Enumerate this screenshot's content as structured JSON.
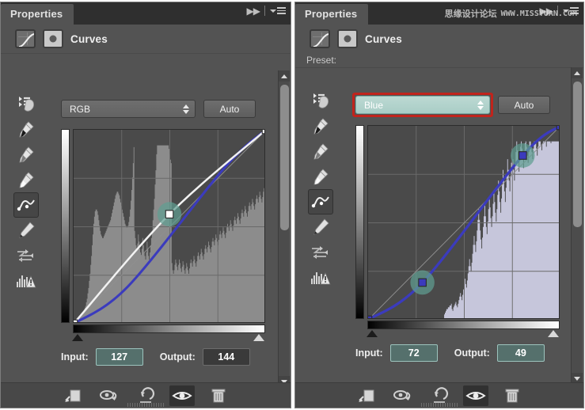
{
  "panels": [
    {
      "id": "left",
      "tab_label": "Properties",
      "adjustment_title": "Curves",
      "preset_label": "",
      "channel": {
        "value": "RGB",
        "highlighted": false
      },
      "auto_label": "Auto",
      "input": {
        "label": "Input:",
        "value": "127",
        "highlighted": true
      },
      "output": {
        "label": "Output:",
        "value": "144",
        "highlighted": false
      }
    },
    {
      "id": "right",
      "tab_label": "Properties",
      "adjustment_title": "Curves",
      "preset_label": "Preset:",
      "channel": {
        "value": "Blue",
        "highlighted": true
      },
      "auto_label": "Auto",
      "input": {
        "label": "Input:",
        "value": "72",
        "highlighted": true
      },
      "output": {
        "label": "Output:",
        "value": "49",
        "highlighted": true
      }
    }
  ],
  "watermark": {
    "cn": "思缘设计论坛",
    "en": "WWW.MISSYUAN.COM"
  },
  "tools": [
    {
      "name": "targeted-adjustment-tool",
      "label": "Targeted Adjustment Tool",
      "active": false
    },
    {
      "name": "black-point-eyedropper",
      "label": "Sample in Image to Set Black Point",
      "active": false
    },
    {
      "name": "gray-point-eyedropper",
      "label": "Sample in Image to Set Gray Point",
      "active": false
    },
    {
      "name": "white-point-eyedropper",
      "label": "Sample in Image to Set White Point",
      "active": false
    },
    {
      "name": "edit-points-curve-tool",
      "label": "Edit Points to Modify the Curve",
      "active": true
    },
    {
      "name": "pencil-draw-curve-tool",
      "label": "Draw to Modify the Curve",
      "active": false
    },
    {
      "name": "smooth-curve-values",
      "label": "Smooth the Curve Values",
      "active": false
    },
    {
      "name": "curves-display-options",
      "label": "Curves Display Options",
      "active": false
    }
  ],
  "bottom_toolbar": [
    {
      "name": "clip-to-layer-button",
      "label": "Clip to Layer",
      "active": false
    },
    {
      "name": "view-previous-state-button",
      "label": "View Previous State",
      "active": false
    },
    {
      "name": "reset-adjustment-button",
      "label": "Reset to Adjustment Defaults",
      "active": false
    },
    {
      "name": "toggle-layer-visibility-button",
      "label": "Toggle Layer Visibility",
      "active": true
    },
    {
      "name": "delete-adjustment-layer-button",
      "label": "Delete This Adjustment Layer",
      "active": false
    }
  ],
  "colors": {
    "panel_bg": "#535353",
    "titlebar_bg": "#2f2f2f",
    "plot_bg": "#4a4a4a",
    "blue_curve": "#3b3bbd",
    "white_curve": "#f2f2f2",
    "highlight_red": "#c0241c",
    "highlight_teal": "#a9cdc6",
    "point_glow": "#5f9e91",
    "histogram_gray": "#b4b4b4",
    "histogram_blue": "#dcdcf5"
  },
  "chart_data": [
    {
      "type": "line",
      "title": "RGB Curve",
      "xlabel": "Input",
      "ylabel": "Output",
      "xlim": [
        0,
        255
      ],
      "ylim": [
        0,
        255
      ],
      "grid": true,
      "series": [
        {
          "name": "white-composite-curve",
          "color": "#f2f2f2",
          "points": [
            [
              0,
              0
            ],
            [
              127,
              144
            ],
            [
              255,
              255
            ]
          ]
        },
        {
          "name": "blue-channel-curve",
          "color": "#3b3bbd",
          "points": [
            [
              0,
              0
            ],
            [
              72,
              49
            ],
            [
              200,
              205
            ],
            [
              255,
              255
            ]
          ]
        },
        {
          "name": "baseline-diagonal",
          "color": "#8a8a8a",
          "points": [
            [
              0,
              0
            ],
            [
              255,
              255
            ]
          ]
        }
      ],
      "control_points": [
        {
          "input": 0,
          "output": 0,
          "selected": false
        },
        {
          "input": 127,
          "output": 144,
          "selected": true
        },
        {
          "input": 255,
          "output": 255,
          "selected": false
        }
      ],
      "histogram_color": "#b4b4b4",
      "histogram": [
        2,
        2,
        2,
        2,
        3,
        3,
        3,
        4,
        4,
        5,
        5,
        6,
        6,
        7,
        8,
        9,
        10,
        12,
        14,
        17,
        20,
        24,
        28,
        33,
        38,
        44,
        50,
        56,
        60,
        63,
        64,
        64,
        63,
        61,
        58,
        55,
        52,
        50,
        49,
        48,
        48,
        49,
        50,
        51,
        52,
        53,
        54,
        55,
        56,
        57,
        58,
        60,
        62,
        64,
        66,
        68,
        70,
        72,
        73,
        74,
        74,
        73,
        72,
        70,
        68,
        66,
        64,
        62,
        60,
        58,
        56,
        55,
        54,
        54,
        55,
        57,
        60,
        64,
        69,
        75,
        82,
        90,
        99,
        52,
        48,
        44,
        42,
        45,
        50,
        46,
        42,
        40,
        38,
        42,
        48,
        44,
        40,
        38,
        36,
        40,
        46,
        42,
        38,
        36,
        40,
        44,
        48,
        52,
        58,
        64,
        70,
        78,
        86,
        95,
        100,
        100,
        100,
        100,
        100,
        100,
        100,
        100,
        100,
        100,
        100,
        100,
        100,
        100,
        100,
        100,
        98,
        95,
        92,
        90,
        34,
        30,
        28,
        30,
        33,
        36,
        34,
        32,
        30,
        33,
        36,
        34,
        31,
        29,
        32,
        35,
        33,
        30,
        28,
        31,
        34,
        32,
        30,
        28,
        31,
        34,
        36,
        34,
        32,
        35,
        38,
        36,
        34,
        32,
        35,
        38,
        40,
        38,
        36,
        39,
        42,
        40,
        38,
        36,
        39,
        42,
        44,
        42,
        40,
        43,
        46,
        44,
        42,
        40,
        43,
        46,
        48,
        46,
        44,
        47,
        50,
        48,
        46,
        44,
        47,
        50,
        52,
        50,
        48,
        51,
        54,
        52,
        50,
        48,
        51,
        54,
        56,
        54,
        52,
        55,
        58,
        56,
        54,
        52,
        55,
        58,
        60,
        58,
        56,
        59,
        62,
        60,
        58,
        56,
        59,
        62,
        64,
        62,
        60,
        63,
        66,
        64,
        62,
        60,
        63,
        66,
        68,
        66,
        64,
        67,
        70,
        68,
        66,
        64,
        67,
        70,
        72,
        70,
        68,
        71,
        74,
        72,
        70,
        68,
        71,
        74,
        76,
        74,
        72
      ]
    },
    {
      "type": "line",
      "title": "Blue Curve",
      "xlabel": "Input",
      "ylabel": "Output",
      "xlim": [
        0,
        255
      ],
      "ylim": [
        0,
        255
      ],
      "grid": true,
      "series": [
        {
          "name": "blue-channel-curve",
          "color": "#3b3bbd",
          "points": [
            [
              0,
              0
            ],
            [
              72,
              49
            ],
            [
              205,
              216
            ],
            [
              255,
              255
            ]
          ]
        },
        {
          "name": "baseline-diagonal",
          "color": "#8a8a8a",
          "points": [
            [
              0,
              0
            ],
            [
              255,
              255
            ]
          ]
        }
      ],
      "control_points": [
        {
          "input": 0,
          "output": 0,
          "selected": false
        },
        {
          "input": 72,
          "output": 49,
          "selected": true
        },
        {
          "input": 205,
          "output": 216,
          "selected": true
        },
        {
          "input": 255,
          "output": 255,
          "selected": false
        }
      ],
      "histogram_color": "#dcdcf5",
      "histogram": [
        0,
        0,
        0,
        0,
        0,
        0,
        0,
        0,
        0,
        0,
        0,
        0,
        0,
        0,
        0,
        0,
        0,
        0,
        0,
        0,
        0,
        0,
        0,
        0,
        0,
        0,
        0,
        0,
        0,
        0,
        0,
        0,
        0,
        0,
        0,
        0,
        0,
        0,
        0,
        0,
        0,
        0,
        0,
        0,
        0,
        0,
        0,
        0,
        0,
        0,
        0,
        0,
        0,
        0,
        0,
        0,
        0,
        0,
        0,
        0,
        0,
        0,
        0,
        0,
        0,
        0,
        0,
        0,
        0,
        0,
        0,
        0,
        0,
        0,
        0,
        0,
        0,
        0,
        0,
        0,
        0,
        0,
        0,
        0,
        0,
        0,
        0,
        0,
        0,
        0,
        0,
        0,
        0,
        0,
        0,
        0,
        0,
        0,
        0,
        0,
        3,
        4,
        5,
        6,
        6,
        7,
        7,
        8,
        8,
        9,
        6,
        5,
        7,
        8,
        9,
        10,
        8,
        7,
        9,
        11,
        13,
        15,
        13,
        11,
        14,
        17,
        20,
        23,
        20,
        18,
        22,
        26,
        30,
        34,
        30,
        27,
        32,
        37,
        42,
        47,
        42,
        38,
        44,
        50,
        56,
        62,
        56,
        50,
        45,
        40,
        46,
        52,
        58,
        64,
        58,
        52,
        48,
        55,
        62,
        69,
        63,
        57,
        52,
        58,
        65,
        72,
        66,
        60,
        55,
        62,
        70,
        78,
        72,
        66,
        60,
        68,
        76,
        84,
        78,
        72,
        66,
        74,
        82,
        90,
        84,
        78,
        72,
        80,
        88,
        96,
        90,
        84,
        78,
        86,
        94,
        100,
        95,
        89,
        83,
        90,
        97,
        100,
        96,
        90,
        85,
        92,
        99,
        100,
        97,
        92,
        88,
        94,
        100,
        100,
        98,
        94,
        90,
        96,
        100,
        100,
        99,
        96,
        92,
        97,
        100,
        100,
        100,
        98,
        95,
        99,
        100,
        100,
        100,
        100,
        97,
        100,
        100,
        100,
        100,
        100,
        99,
        100,
        100,
        100,
        100,
        100,
        100,
        100,
        100,
        100,
        100,
        100,
        100
      ]
    }
  ]
}
